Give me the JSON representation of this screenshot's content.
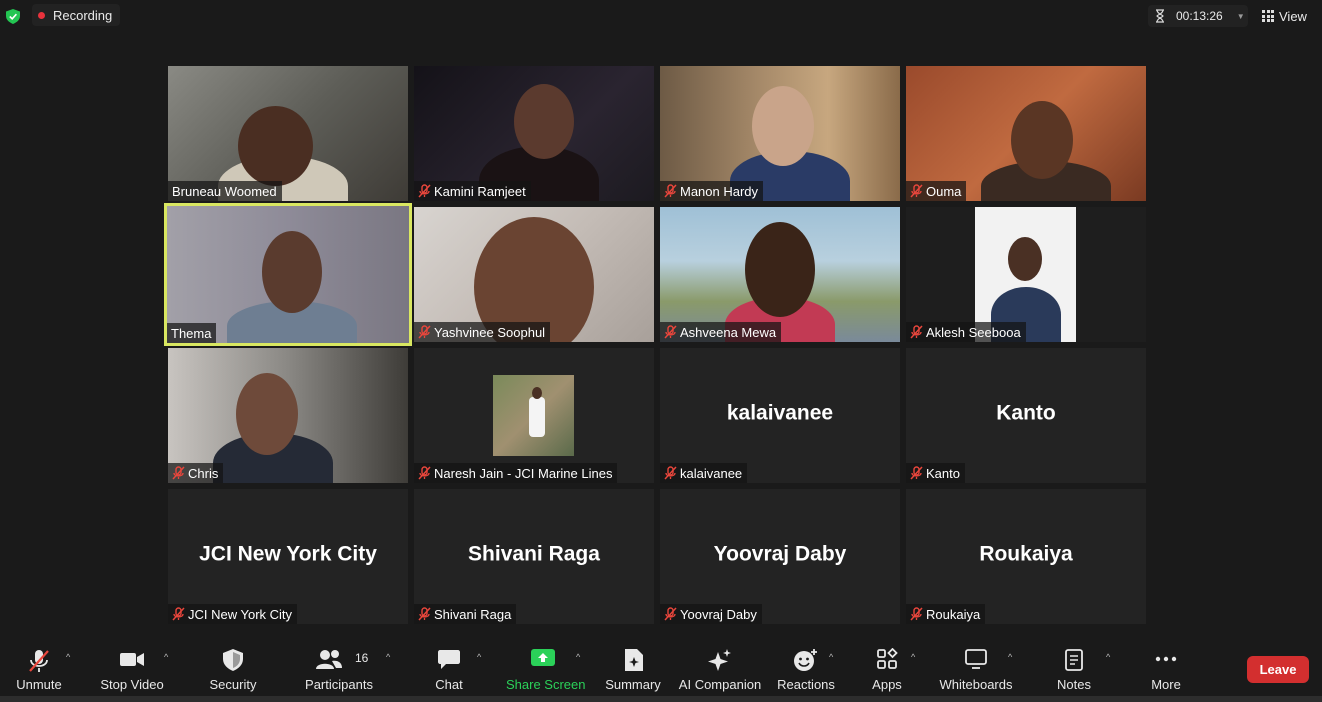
{
  "top_bar": {
    "recording_label": "Recording",
    "timer": "00:13:26",
    "view_label": "View",
    "colors": {
      "recording_dot": "#e8323c",
      "shield": "#23c552"
    }
  },
  "participants": [
    {
      "name": "Bruneau Woomed",
      "muted": false,
      "video": true
    },
    {
      "name": "Kamini Ramjeet",
      "muted": true,
      "video": true
    },
    {
      "name": "Manon Hardy",
      "muted": true,
      "video": true
    },
    {
      "name": "Ouma",
      "muted": true,
      "video": true
    },
    {
      "name": "Thema",
      "muted": false,
      "video": true,
      "active_speaker": true
    },
    {
      "name": "Yashvinee Soophul",
      "muted": true,
      "video": true
    },
    {
      "name": "Ashveena Mewa",
      "muted": true,
      "video": true
    },
    {
      "name": "Aklesh Seebooa",
      "muted": true,
      "video": true
    },
    {
      "name": "Chris",
      "muted": true,
      "video": true
    },
    {
      "name": "Naresh Jain - JCI Marine Lines",
      "muted": true,
      "video": false,
      "avatar_photo": true
    },
    {
      "name": "kalaivanee",
      "muted": true,
      "video": false,
      "display_name": "kalaivanee"
    },
    {
      "name": "Kanto",
      "muted": true,
      "video": false,
      "display_name": "Kanto"
    },
    {
      "name": "JCI New York City",
      "muted": true,
      "video": false,
      "display_name": "JCI New York City"
    },
    {
      "name": "Shivani Raga",
      "muted": true,
      "video": false,
      "display_name": "Shivani Raga"
    },
    {
      "name": "Yoovraj Daby",
      "muted": true,
      "video": false,
      "display_name": "Yoovraj Daby"
    },
    {
      "name": "Roukaiya",
      "muted": true,
      "video": false,
      "display_name": "Roukaiya"
    }
  ],
  "toolbar": {
    "unmute": "Unmute",
    "stop_video": "Stop Video",
    "security": "Security",
    "participants": "Participants",
    "participant_count": "16",
    "chat": "Chat",
    "share_screen": "Share Screen",
    "summary": "Summary",
    "ai_companion": "AI Companion",
    "reactions": "Reactions",
    "apps": "Apps",
    "whiteboards": "Whiteboards",
    "notes": "Notes",
    "more": "More",
    "leave": "Leave",
    "colors": {
      "share": "#2bd159",
      "leave": "#d32f2f",
      "active_speaker_border": "#d9e761"
    }
  }
}
